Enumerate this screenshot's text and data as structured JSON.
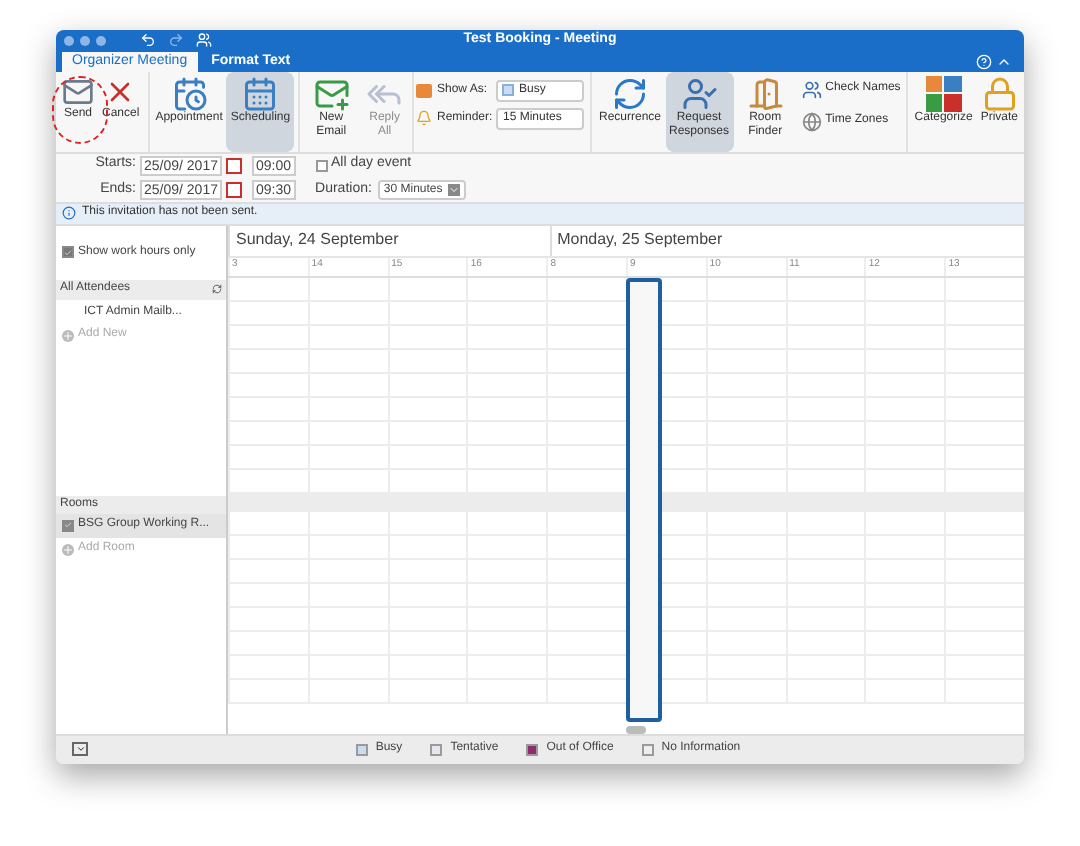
{
  "window": {
    "title": "Test Booking - Meeting"
  },
  "tabs": [
    {
      "label": "Organizer Meeting",
      "selected": true
    },
    {
      "label": "Format Text",
      "selected": false
    }
  ],
  "ribbon": {
    "groups": [
      {
        "buttons": [
          {
            "label": "Send",
            "selected": false,
            "disabled": false
          },
          {
            "label": "Cancel",
            "selected": false,
            "disabled": false
          }
        ]
      },
      {
        "buttons": [
          {
            "label": "Appointment",
            "selected": false,
            "disabled": false
          },
          {
            "label": "Scheduling",
            "selected": true,
            "disabled": false
          }
        ]
      },
      {
        "buttons": [
          {
            "label": "New Email",
            "selected": false,
            "disabled": false
          },
          {
            "label": "Reply All",
            "selected": false,
            "disabled": true
          }
        ]
      }
    ],
    "show_as": {
      "label": "Show As:",
      "value": "Busy"
    },
    "reminder": {
      "label": "Reminder:",
      "value": "15 Minutes"
    },
    "options": [
      {
        "label": "Recurrence",
        "selected": false
      },
      {
        "label": "Request Responses",
        "selected": true
      },
      {
        "label": "Room Finder",
        "selected": false
      }
    ],
    "small_buttons": [
      "Check Names",
      "Time Zones"
    ],
    "tags": [
      {
        "label": "Categorize"
      },
      {
        "label": "Private"
      }
    ]
  },
  "times": {
    "starts_label": "Starts:",
    "start_date": "25/09/ 2017",
    "start_time": "09:00",
    "ends_label": "Ends:",
    "end_date": "25/09/ 2017",
    "end_time": "09:30",
    "all_day": {
      "label": "All day event",
      "checked": false
    },
    "duration_label": "Duration:",
    "duration": "30 Minutes"
  },
  "info_bar": "This invitation has not been sent.",
  "work_hours": {
    "label": "Show work hours only",
    "checked": true
  },
  "attendees": {
    "header": "All Attendees",
    "items": [
      "ICT Admin Mailb..."
    ],
    "add": "Add New"
  },
  "rooms": {
    "header": "Rooms",
    "items": [
      {
        "name": "BSG Group Working R...",
        "checked": true
      }
    ],
    "add": "Add Room"
  },
  "days": [
    {
      "label": "Sunday, 24 September",
      "hours": [
        {
          "label": "3",
          "selected": false
        },
        {
          "label": "14",
          "selected": false
        },
        {
          "label": "15",
          "selected": false
        },
        {
          "label": "16",
          "selected": false
        }
      ]
    },
    {
      "label": "Monday, 25 September",
      "hours": [
        {
          "label": "8",
          "selected": false
        },
        {
          "label": "9",
          "selected": true
        },
        {
          "label": "10",
          "selected": false
        },
        {
          "label": "11",
          "selected": false
        },
        {
          "label": "12",
          "selected": false
        },
        {
          "label": "13",
          "selected": false
        }
      ]
    }
  ],
  "legend": [
    {
      "label": "Busy",
      "color": "#c8dcf2"
    },
    {
      "label": "Tentative",
      "color": "#e4e8ee"
    },
    {
      "label": "Out of Office",
      "color": "#8e2c6c"
    },
    {
      "label": "No Information",
      "color": "#eeeeee"
    }
  ]
}
